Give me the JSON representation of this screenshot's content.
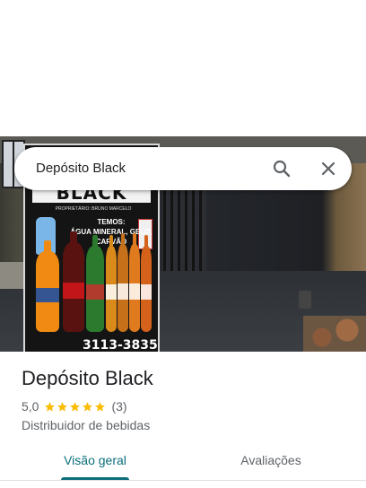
{
  "search": {
    "query": "Depósito Black"
  },
  "place": {
    "name": "Depósito Black",
    "rating": "5,0",
    "stars": 5,
    "review_count": "(3)",
    "category": "Distribuidor de bebidas"
  },
  "tabs": [
    {
      "label": "Visão geral",
      "selected": true
    },
    {
      "label": "Avaliações",
      "selected": false
    }
  ],
  "photo_sign": {
    "name": "BLACK",
    "owner": "PROPRIETÁRIO: BRUNO MARCELO",
    "temos": "TEMOS:",
    "products": "ÁGUA MINERAL, GELO, CARVÃO",
    "phone": "3113-3835"
  },
  "colors": {
    "accent": "#0b6e7a",
    "star": "#fbbc04",
    "text_primary": "#202124",
    "text_secondary": "#5f6368"
  },
  "icons": [
    "search-icon",
    "close-icon",
    "star-icon"
  ]
}
